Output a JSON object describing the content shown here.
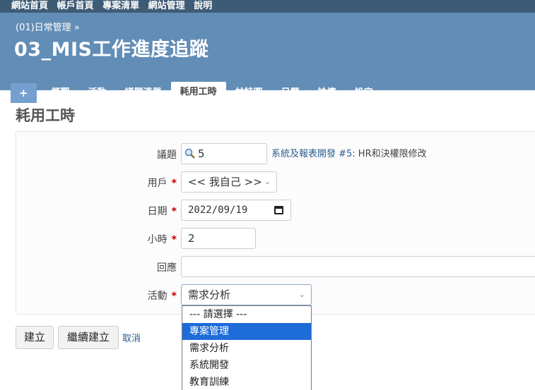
{
  "topbar": {
    "items": [
      "網站首頁",
      "帳戶首頁",
      "專案清單",
      "網站管理",
      "說明"
    ]
  },
  "header": {
    "breadcrumb": "(01)日常管理 »",
    "project_title": "03_MIS工作進度追蹤"
  },
  "tabs": [
    {
      "label": "+"
    },
    {
      "label": "概觀"
    },
    {
      "label": "活動"
    },
    {
      "label": "議題清單"
    },
    {
      "label": "耗用工時"
    },
    {
      "label": "甘特圖"
    },
    {
      "label": "日曆"
    },
    {
      "label": "論壇"
    },
    {
      "label": "設定"
    }
  ],
  "page": {
    "heading": "耗用工時"
  },
  "form": {
    "issue": {
      "label": "議題",
      "value": "5",
      "link_text": "系統及報表開發 #5",
      "link_suffix": ": HR和決權限修改"
    },
    "user": {
      "label": "用戶",
      "value": "<< 我自己 >>"
    },
    "date": {
      "label": "日期",
      "value": "2022/09/19"
    },
    "hours": {
      "label": "小時",
      "value": "2"
    },
    "comment": {
      "label": "回應",
      "value": ""
    },
    "activity": {
      "label": "活動",
      "value": "需求分析",
      "options": [
        "--- 請選擇 ---",
        "專案管理",
        "需求分析",
        "系統開發",
        "教育訓練"
      ]
    },
    "required_mark": "*"
  },
  "buttons": {
    "create": "建立",
    "continue": "繼續建立",
    "cancel": "取消"
  }
}
